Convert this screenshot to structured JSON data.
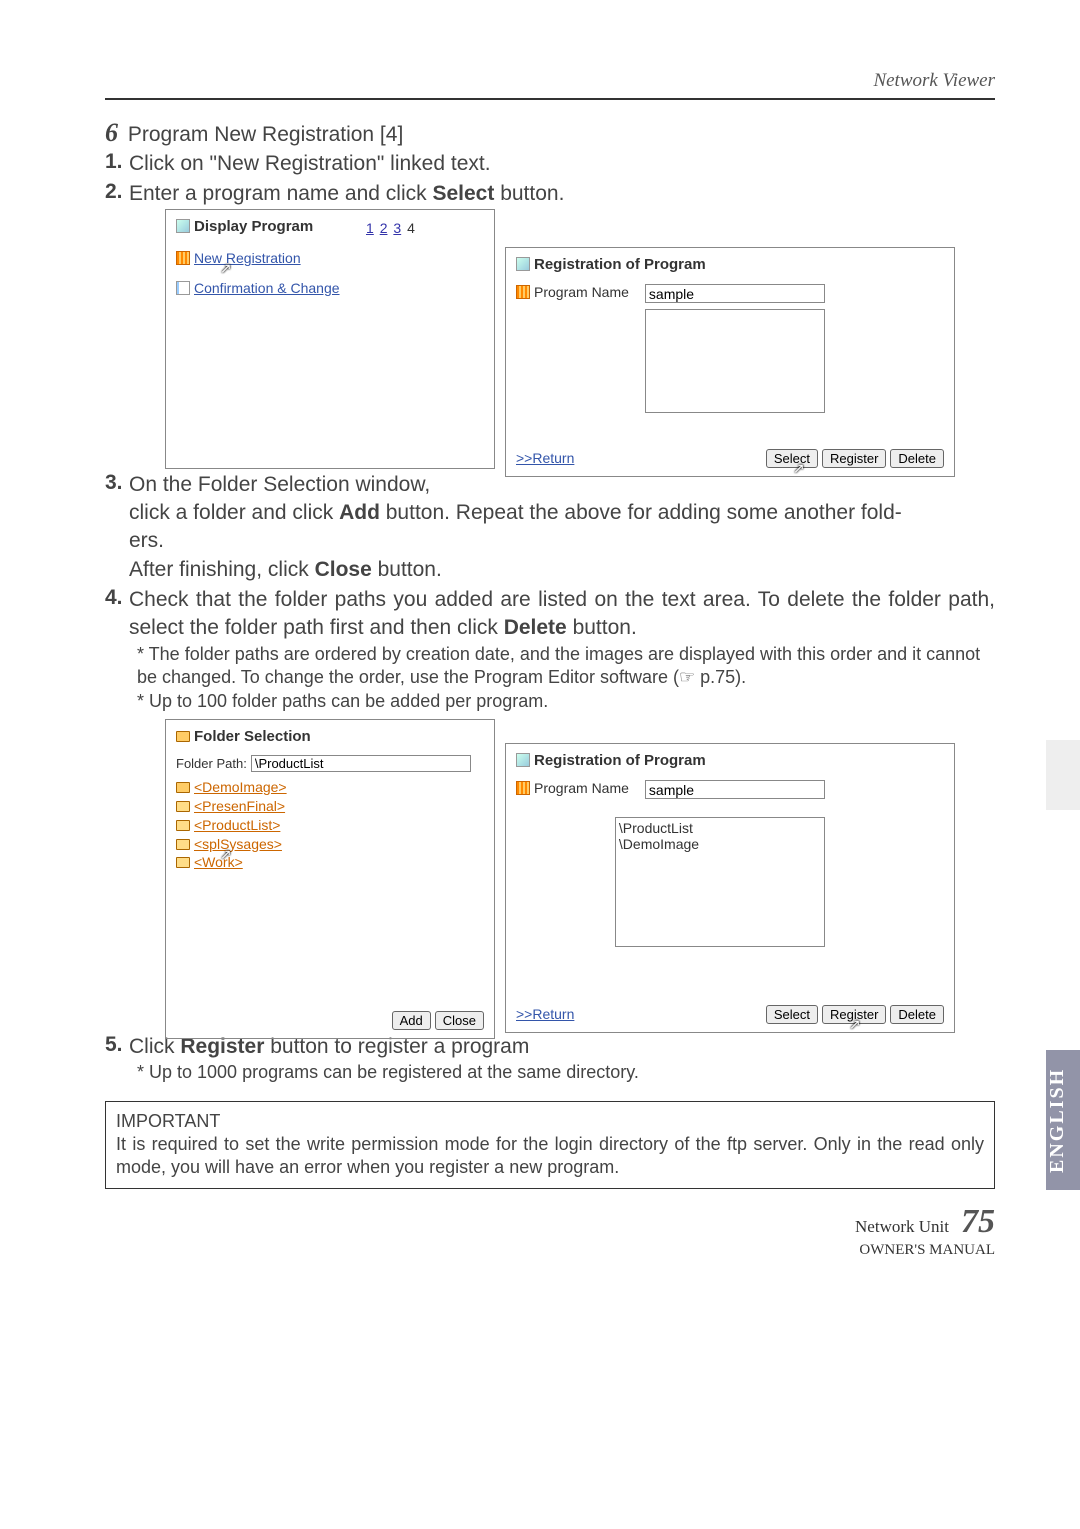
{
  "header": {
    "section": "Network Viewer"
  },
  "step6": {
    "num": "6",
    "title": "Program New Registration [4]"
  },
  "list1": {
    "n": "1.",
    "t": "Click on \"New Registration\" linked text."
  },
  "list2": {
    "n": "2.",
    "t_pre": "Enter a program name and click ",
    "t_bold": "Select",
    "t_post": " button."
  },
  "screenshotA": {
    "dp_title": "Display Program",
    "dp_nums": [
      "1",
      "2",
      "3",
      "4"
    ],
    "link_new": "New Registration",
    "link_conf": "Confirmation & Change"
  },
  "screenshotB": {
    "title": "Registration of Program",
    "prog_label": "Program Name",
    "prog_value": "sample",
    "return": ">>Return",
    "btn_select": "Select",
    "btn_register": "Register",
    "btn_delete": "Delete"
  },
  "list3": {
    "n": "3.",
    "line1": "On the Folder Selection window,",
    "line2_pre": "click a folder and click ",
    "line2_bold": "Add",
    "line2_mid": " button. Repeat the above for adding some another fold-",
    "line3": "ers.",
    "line4_pre": " After finishing, click ",
    "line4_bold": "Close",
    "line4_post": " button."
  },
  "list4": {
    "n": "4.",
    "t_pre": "Check that the folder paths you added are listed on the text area. To delete the folder path, select the folder path first and then click ",
    "t_bold": "Delete",
    "t_post": " button."
  },
  "note4a": "* The folder paths are ordered by creation date, and the images are displayed with this order and it cannot be changed. To change the order, use the Program Editor software (☞ p.75).",
  "note4b": "* Up to 100 folder paths can be added per program.",
  "screenshotC": {
    "title": "Folder Selection",
    "fp_label": "Folder Path:",
    "fp_value": "\\ProductList",
    "folders": [
      "<DemoImage>",
      "<PresenFinal>",
      "<ProductList>",
      "<splSysages>",
      "<Work>"
    ],
    "btn_add": "Add",
    "btn_close": "Close"
  },
  "screenshotD": {
    "title": "Registration of Program",
    "prog_label": "Program Name",
    "prog_value": "sample",
    "paths": "\\ProductList\n\\DemoImage",
    "return": ">>Return",
    "btn_select": "Select",
    "btn_register": "Register",
    "btn_delete": "Delete"
  },
  "list5": {
    "n": "5.",
    "t_pre": "Click ",
    "t_bold": "Register",
    "t_post": " button to register a program"
  },
  "note5": "* Up to 1000 programs can be registered at the same directory.",
  "important": {
    "heading": "IMPORTANT",
    "body": "It is required to set the write permission mode for the login directory of the ftp server. Only in the read only mode, you will have an error when you register a new program."
  },
  "footer": {
    "nw": "Network Unit",
    "page": "75",
    "om": "OWNER'S MANUAL"
  },
  "sidetab": "ENGLISH"
}
